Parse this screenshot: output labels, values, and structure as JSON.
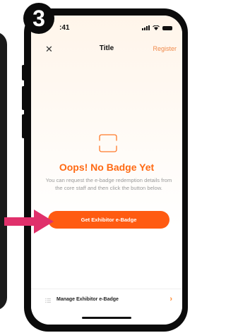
{
  "step": {
    "number": "3"
  },
  "status_bar": {
    "time": ":41"
  },
  "nav": {
    "close_symbol": "✕",
    "title": "Title",
    "register_label": "Register"
  },
  "empty_state": {
    "icon": "scan-frame-icon",
    "title": "Oops! No Badge Yet",
    "description": "You can request the e-badge redemption details from the core staff and then click the button below.",
    "button_label": "Get Exhibitor e-Badge"
  },
  "bottom": {
    "label": "Manage Exhibitor e-Badge",
    "chevron": "›"
  },
  "colors": {
    "accent": "#ff5b12",
    "title_orange": "#ff6a13",
    "register": "#f08a4b",
    "arrow": "#e0306b"
  }
}
